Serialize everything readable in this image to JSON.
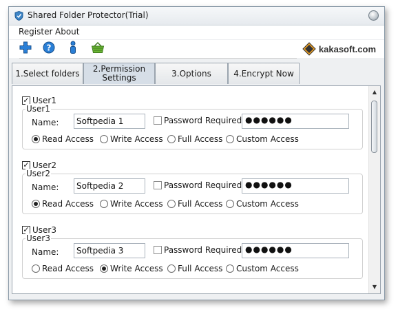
{
  "window": {
    "title": "Shared Folder Protector(Trial)"
  },
  "menu": {
    "register": "Register",
    "about": "About"
  },
  "toolbar": {
    "icons": [
      "plus-icon",
      "help-icon",
      "info-icon",
      "basket-icon"
    ]
  },
  "brand": {
    "name": "kakasoft.com"
  },
  "tabs": [
    {
      "label": "1.Select folders",
      "active": false
    },
    {
      "label": "2.Permission Settings",
      "active": true
    },
    {
      "label": "3.Options",
      "active": false
    },
    {
      "label": "4.Encrypt Now",
      "active": false
    }
  ],
  "users": [
    {
      "checkbox_label": "User1",
      "checked": true,
      "group_label": "User1",
      "name_label": "Name:",
      "name_value": "Softpedia 1",
      "password_required_label": "Password Required",
      "password_required": false,
      "password_value": "●●●●●●",
      "access_options": [
        "Read Access",
        "Write Access",
        "Full Access",
        "Custom Access"
      ],
      "selected_access": "Read Access"
    },
    {
      "checkbox_label": "User2",
      "checked": true,
      "group_label": "User2",
      "name_label": "Name:",
      "name_value": "Softpedia 2",
      "password_required_label": "Password Required",
      "password_required": false,
      "password_value": "●●●●●●",
      "access_options": [
        "Read Access",
        "Write Access",
        "Full Access",
        "Custom Access"
      ],
      "selected_access": "Read Access"
    },
    {
      "checkbox_label": "User3",
      "checked": true,
      "group_label": "User3",
      "name_label": "Name:",
      "name_value": "Softpedia 3",
      "password_required_label": "Password Required",
      "password_required": false,
      "password_value": "●●●●●●",
      "access_options": [
        "Read Access",
        "Write Access",
        "Full Access",
        "Custom Access"
      ],
      "selected_access": "Write Access"
    }
  ],
  "colors": {
    "window_bg": "#eef0f2",
    "active_tab": "#d6dee7",
    "toolbar_blue": "#1f6fc8",
    "basket_green": "#5aa02c"
  }
}
